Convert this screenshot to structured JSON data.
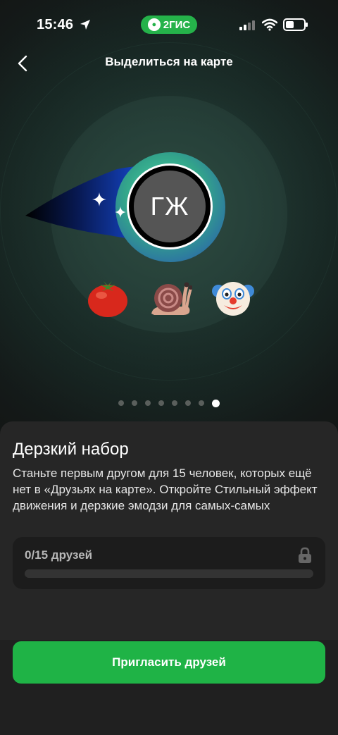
{
  "status_bar": {
    "time": "15:46",
    "app_pill": "2ГИС",
    "battery_level": 0.45
  },
  "nav": {
    "title": "Выделиться на карте",
    "back_icon": "chevron-left-icon"
  },
  "illustration": {
    "avatar_initials": "ГЖ",
    "emojis": [
      "tomato",
      "snail",
      "clown-face"
    ]
  },
  "pagination": {
    "total": 8,
    "active_index": 7
  },
  "sheet": {
    "title": "Дерзкий набор",
    "description": "Станьте первым другом для 15 человек, которых ещё нет в «Друзьях на карте». Откройте Стильный эффект движения и дерзкие эмодзи для самых-самых",
    "progress": {
      "label": "0/15 друзей",
      "value": 0,
      "max": 15,
      "locked": true
    },
    "cta_label": "Пригласить друзей"
  },
  "colors": {
    "accent": "#1fb346",
    "background": "#141414",
    "sheet": "#262626"
  }
}
